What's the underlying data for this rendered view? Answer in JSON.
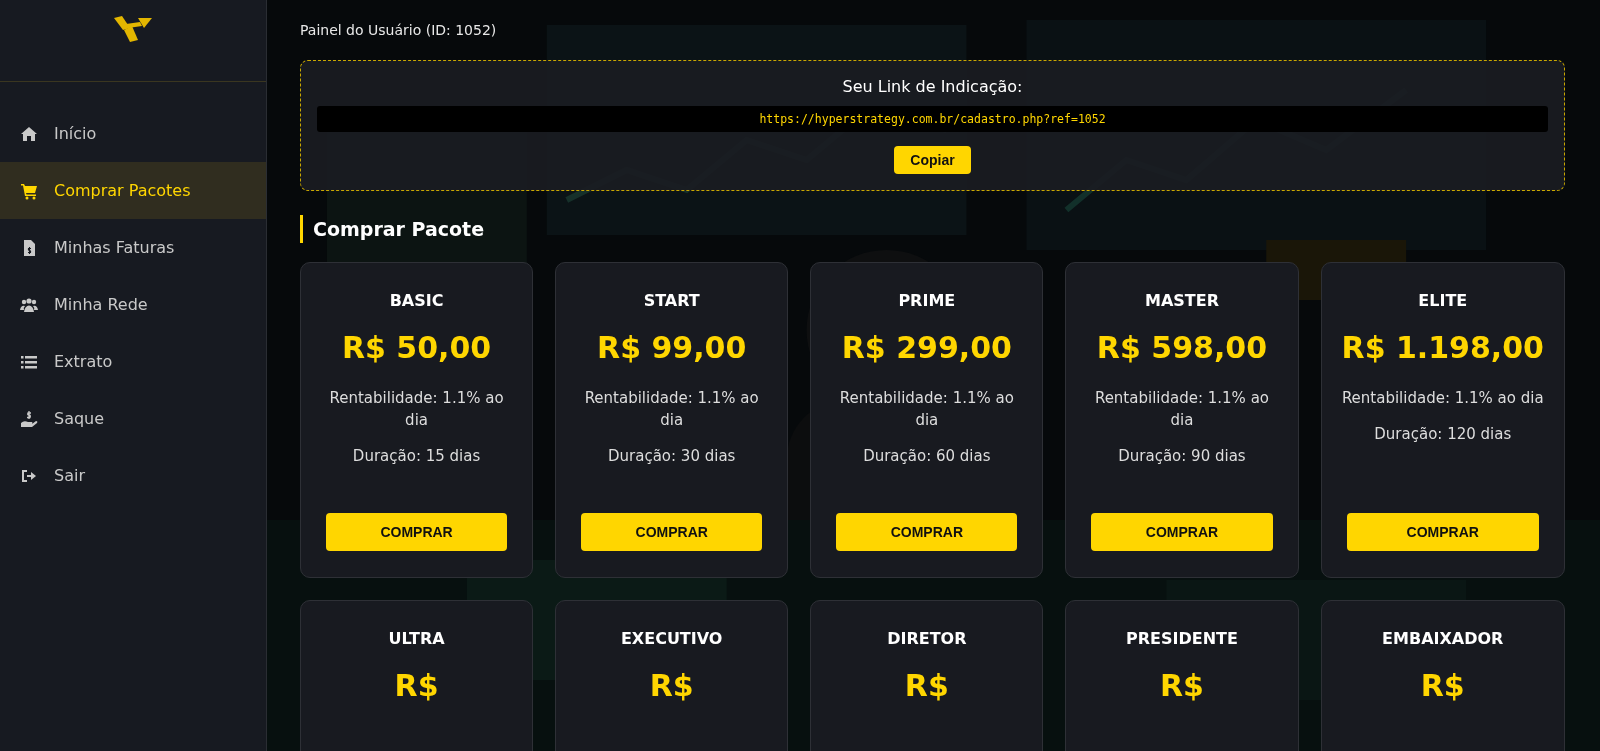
{
  "sidebar": {
    "items": [
      {
        "label": "Início",
        "selected": false
      },
      {
        "label": "Comprar Pacotes",
        "selected": true
      },
      {
        "label": "Minhas Faturas",
        "selected": false
      },
      {
        "label": "Minha Rede",
        "selected": false
      },
      {
        "label": "Extrato",
        "selected": false
      },
      {
        "label": "Saque",
        "selected": false
      },
      {
        "label": "Sair",
        "selected": false
      }
    ]
  },
  "header": {
    "title": "Painel do Usuário (ID: 1052)"
  },
  "referral": {
    "title": "Seu Link de Indicação:",
    "link": "https://hyperstrategy.com.br/cadastro.php?ref=1052",
    "button": "Copiar"
  },
  "section_title": "Comprar Pacote",
  "packages": [
    {
      "name": "BASIC",
      "price": "R$ 50,00",
      "yield": "Rentabilidade: 1.1% ao dia",
      "duration": "Duração: 15 dias",
      "button": "COMPRAR"
    },
    {
      "name": "START",
      "price": "R$ 99,00",
      "yield": "Rentabilidade: 1.1% ao dia",
      "duration": "Duração: 30 dias",
      "button": "COMPRAR"
    },
    {
      "name": "PRIME",
      "price": "R$ 299,00",
      "yield": "Rentabilidade: 1.1% ao dia",
      "duration": "Duração: 60 dias",
      "button": "COMPRAR"
    },
    {
      "name": "MASTER",
      "price": "R$ 598,00",
      "yield": "Rentabilidade: 1.1% ao dia",
      "duration": "Duração: 90 dias",
      "button": "COMPRAR"
    },
    {
      "name": "ELITE",
      "price": "R$ 1.198,00",
      "yield": "Rentabilidade: 1.1% ao dia",
      "duration": "Duração: 120 dias",
      "button": "COMPRAR"
    },
    {
      "name": "ULTRA",
      "price": "R$"
    },
    {
      "name": "EXECUTIVO",
      "price": "R$"
    },
    {
      "name": "DIRETOR",
      "price": "R$"
    },
    {
      "name": "PRESIDENTE",
      "price": "R$"
    },
    {
      "name": "EMBAIXADOR",
      "price": "R$"
    }
  ]
}
